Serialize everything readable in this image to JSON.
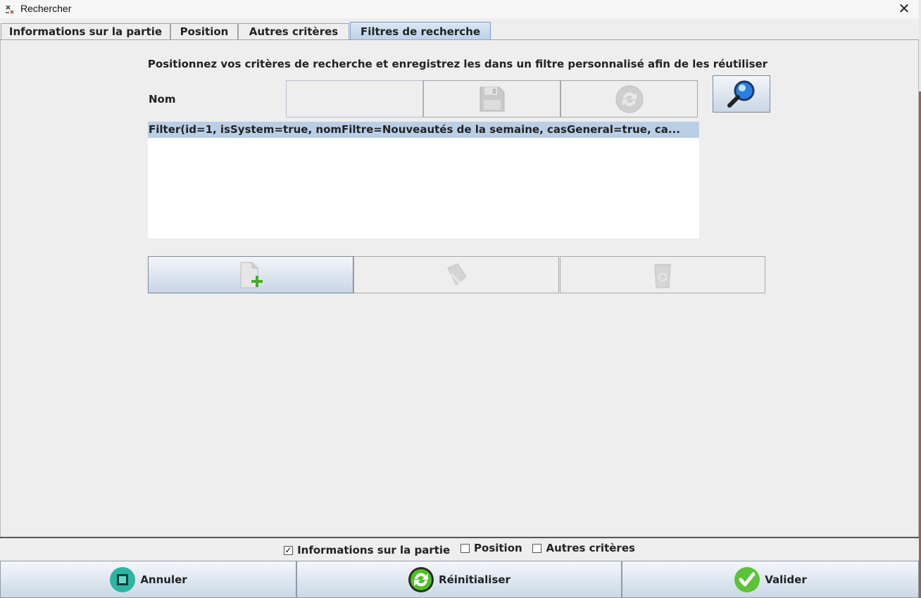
{
  "window": {
    "title": "Rechercher",
    "close_glyph": "✕",
    "icon": "app-icon"
  },
  "tabs": [
    {
      "label": "Informations sur la partie",
      "active": false
    },
    {
      "label": "Position",
      "active": false
    },
    {
      "label": "Autres critères",
      "active": false
    },
    {
      "label": "Filtres de recherche",
      "active": true
    }
  ],
  "filters": {
    "instruction": "Positionnez vos critères de recherche et enregistrez les dans un filtre personnalisé afin de les réutiliser",
    "name_label": "Nom",
    "name_value": "",
    "list_items": [
      "Filter(id=1, isSystem=true, nomFiltre=Nouveautés de la semaine, casGeneral=true, ca..."
    ],
    "icons": {
      "save": "floppy-disk-icon",
      "refresh": "refresh-icon",
      "search": "magnifier-icon",
      "new": "new-document-icon",
      "edit": "eraser-icon",
      "delete": "trash-icon"
    }
  },
  "bottom": {
    "checks": [
      {
        "label": "Informations sur la partie",
        "checked": true
      },
      {
        "label": "Position",
        "checked": false
      },
      {
        "label": "Autres critères",
        "checked": false
      }
    ],
    "buttons": {
      "cancel": "Annuler",
      "reset": "Réinitialiser",
      "validate": "Valider"
    }
  }
}
